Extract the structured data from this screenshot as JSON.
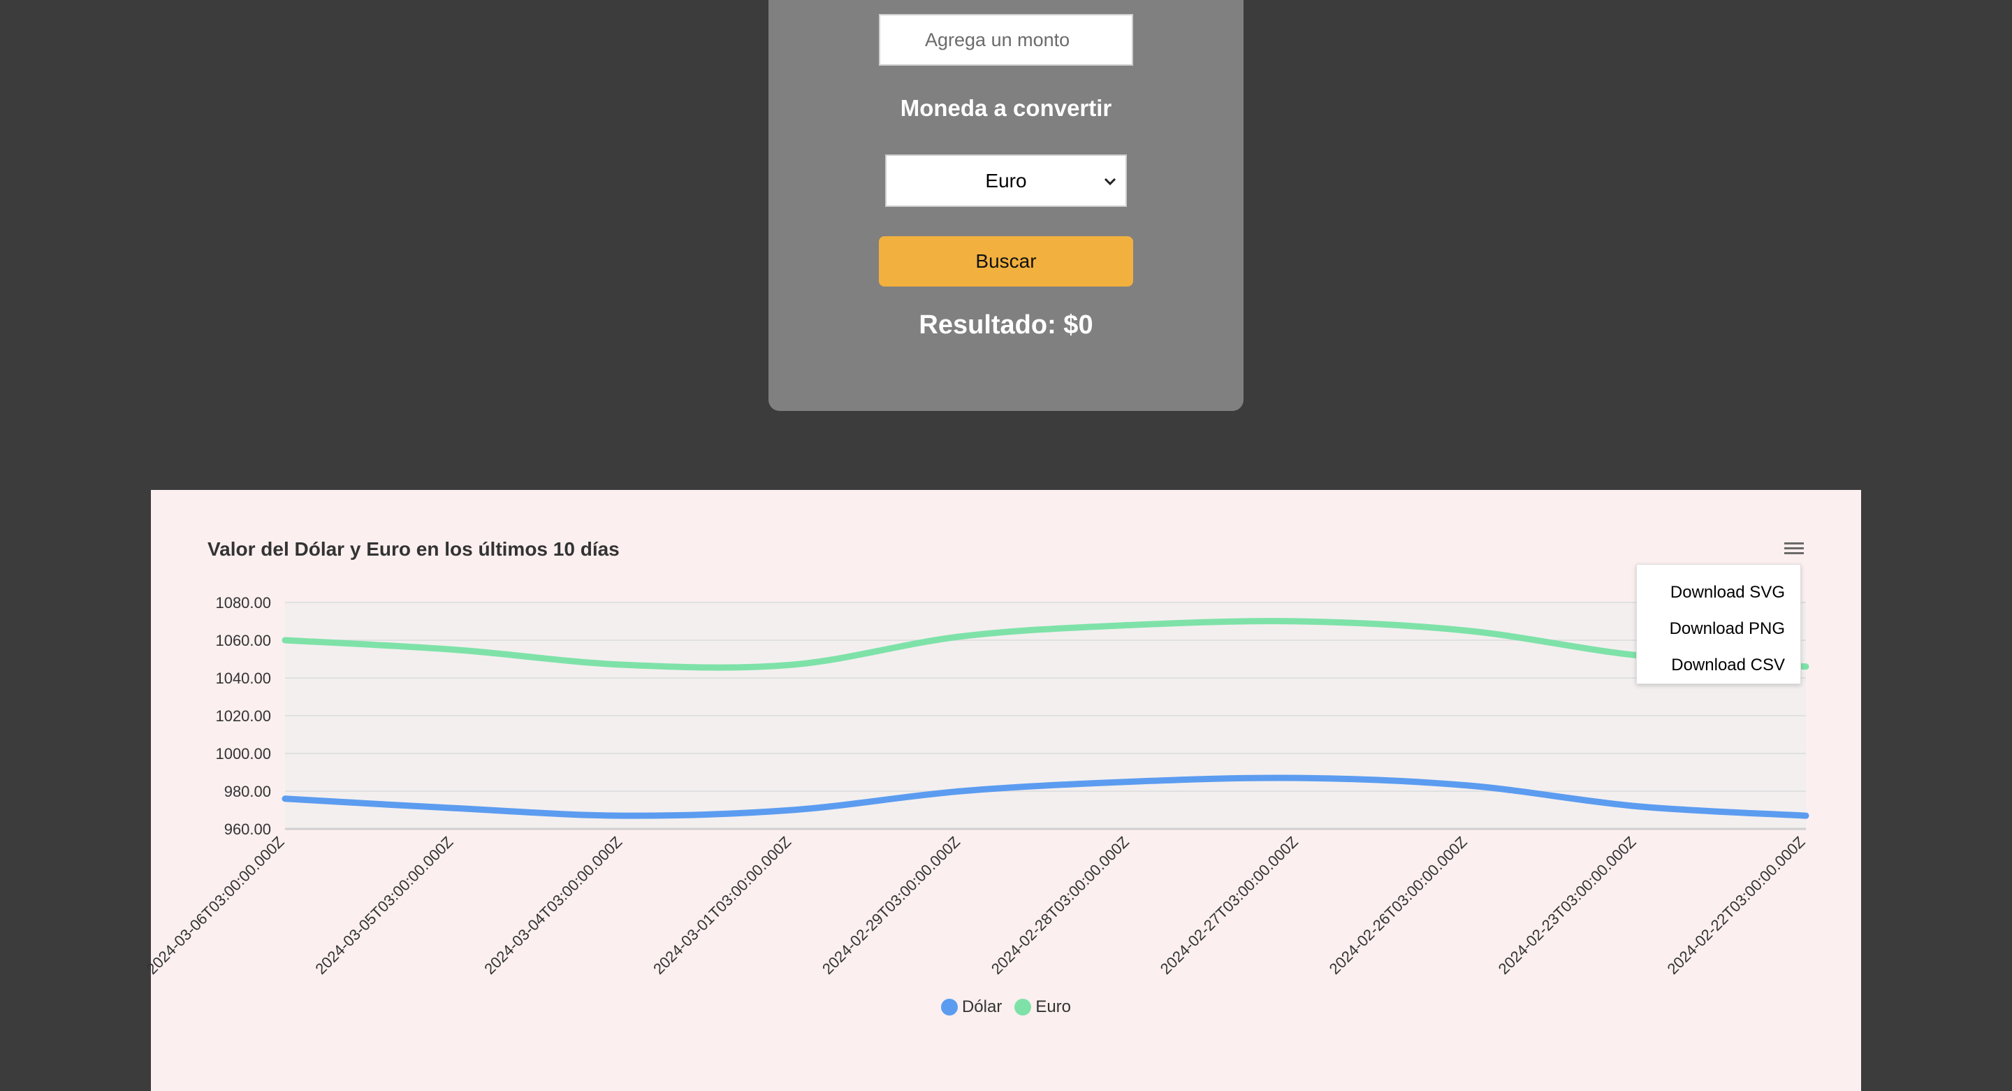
{
  "converter": {
    "amount_placeholder": "Agrega un monto",
    "currency_label": "Moneda a convertir",
    "selected_currency": "Euro",
    "search_label": "Buscar",
    "result_text": "Resultado: $0"
  },
  "chart_menu": {
    "items": [
      "Download SVG",
      "Download PNG",
      "Download CSV"
    ]
  },
  "colors": {
    "page_background": "#3c3c3c",
    "card_background": "#808080",
    "button": "#f2b13e",
    "chart_background": "#fbefef",
    "dolar": "#5b9cf0",
    "euro": "#7ee2a8"
  },
  "chart_data": {
    "type": "line",
    "title": "Valor del Dólar y Euro en los últimos 10 días",
    "categories": [
      "2024-03-06T03:00:00.000Z",
      "2024-03-05T03:00:00.000Z",
      "2024-03-04T03:00:00.000Z",
      "2024-03-01T03:00:00.000Z",
      "2024-02-29T03:00:00.000Z",
      "2024-02-28T03:00:00.000Z",
      "2024-02-27T03:00:00.000Z",
      "2024-02-26T03:00:00.000Z",
      "2024-02-23T03:00:00.000Z",
      "2024-02-22T03:00:00.000Z"
    ],
    "series": [
      {
        "name": "Dólar",
        "color": "#5b9cf0",
        "values": [
          976,
          971,
          967,
          970,
          980,
          985,
          987,
          983,
          972,
          967
        ]
      },
      {
        "name": "Euro",
        "color": "#7ee2a8",
        "values": [
          1060,
          1055,
          1047,
          1047,
          1062,
          1068,
          1070,
          1065,
          1052,
          1046
        ]
      }
    ],
    "ylim": [
      960,
      1080
    ],
    "yticks": [
      "960.00",
      "980.00",
      "1000.00",
      "1020.00",
      "1040.00",
      "1060.00",
      "1080.00"
    ],
    "grid": true,
    "legend": "bottom"
  }
}
